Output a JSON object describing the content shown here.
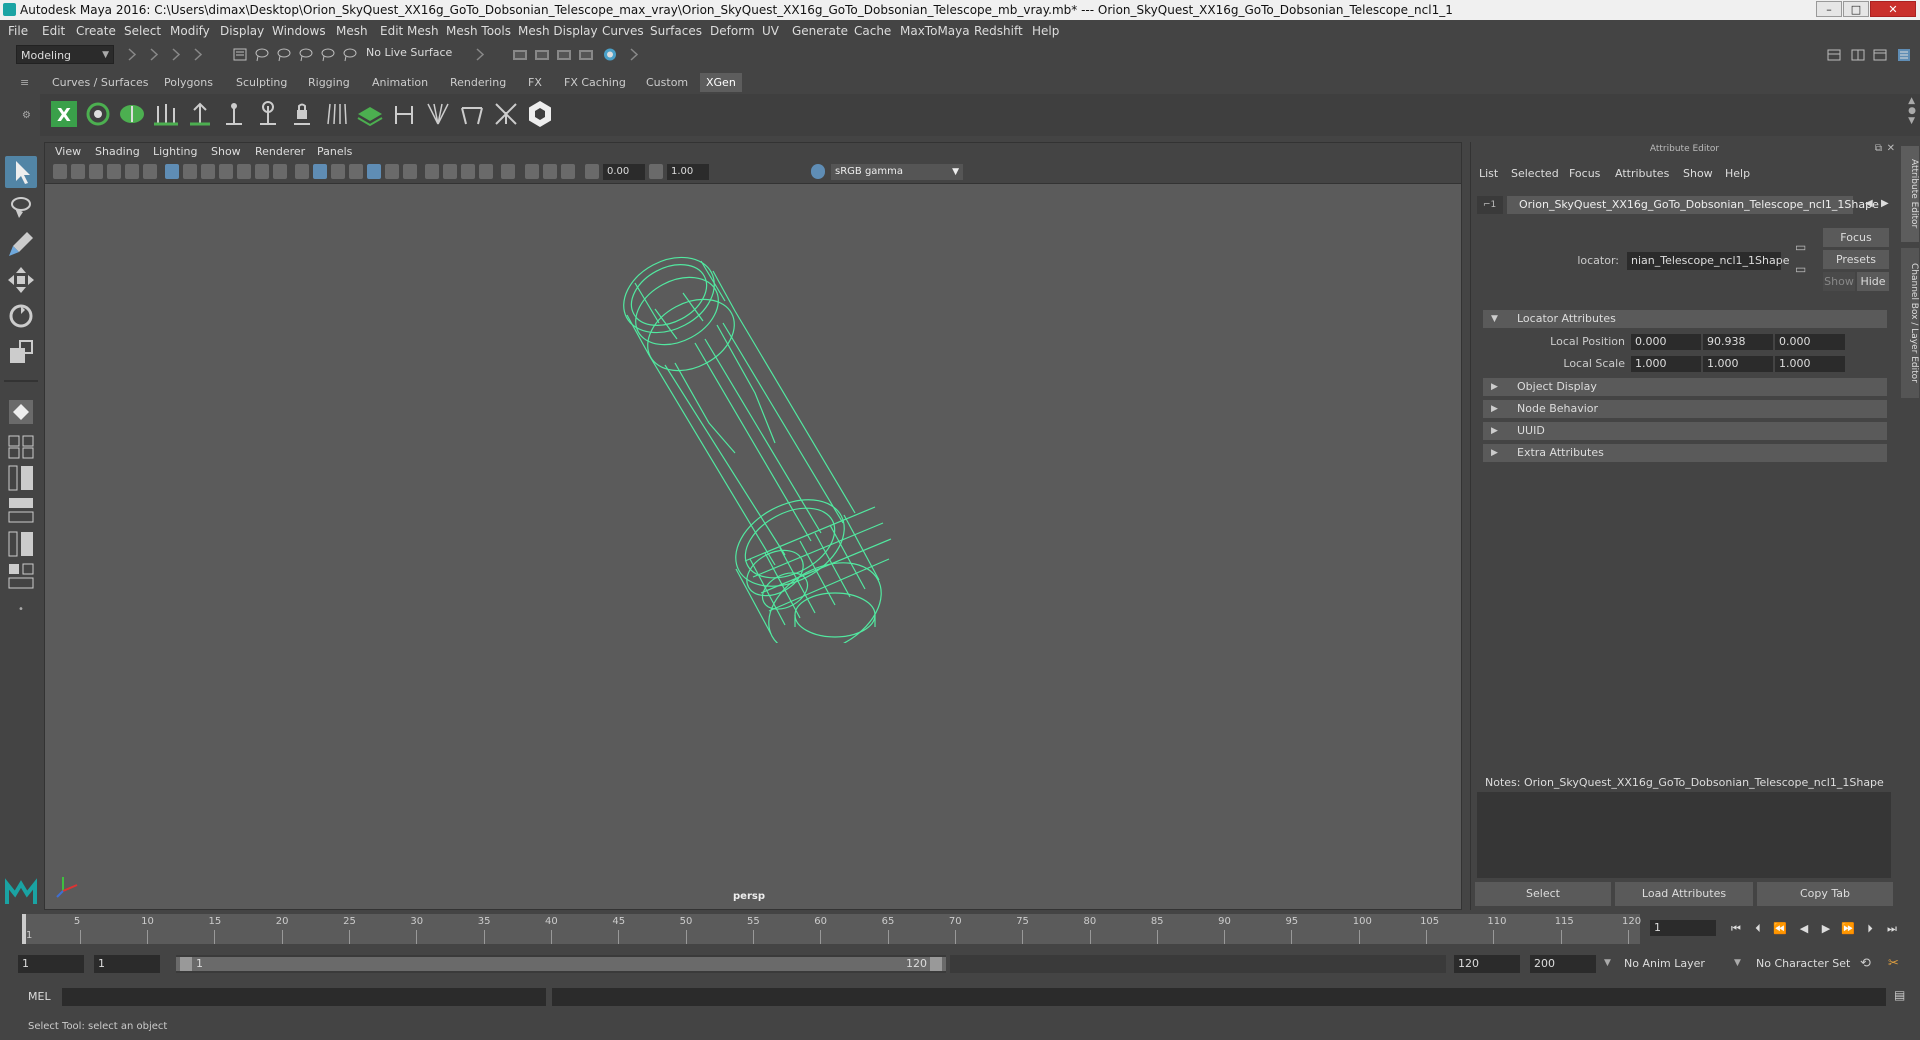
{
  "window": {
    "title": "Autodesk Maya 2016: C:\\Users\\dimax\\Desktop\\Orion_SkyQuest_XX16g_GoTo_Dobsonian_Telescope_max_vray\\Orion_SkyQuest_XX16g_GoTo_Dobsonian_Telescope_mb_vray.mb*   ---   Orion_SkyQuest_XX16g_GoTo_Dobsonian_Telescope_ncl1_1",
    "minimize": "–",
    "maximize": "□",
    "close": "✕"
  },
  "menubar": [
    "File",
    "Edit",
    "Create",
    "Select",
    "Modify",
    "Display",
    "Windows",
    "Mesh",
    "Edit Mesh",
    "Mesh Tools",
    "Mesh Display",
    "Curves",
    "Surfaces",
    "Deform",
    "UV",
    "Generate",
    "Cache",
    "MaxToMaya",
    "Redshift",
    "Help"
  ],
  "status": {
    "mode": "Modeling",
    "live_surface": "No Live Surface"
  },
  "shelf_tabs": [
    "Curves / Surfaces",
    "Polygons",
    "Sculpting",
    "Rigging",
    "Animation",
    "Rendering",
    "FX",
    "FX Caching",
    "Custom",
    "XGen"
  ],
  "active_shelf_tab": "XGen",
  "viewport": {
    "menus": [
      "View",
      "Shading",
      "Lighting",
      "Show",
      "Renderer",
      "Panels"
    ],
    "exposure": "0.00",
    "gamma_value": "1.00",
    "color_space": "sRGB gamma",
    "camera_label": "persp",
    "wire_color": "#52e8a0"
  },
  "attribute_editor": {
    "title": "Attribute Editor",
    "menus": [
      "List",
      "Selected",
      "Focus",
      "Attributes",
      "Show",
      "Help"
    ],
    "node_tab": "Orion_SkyQuest_XX16g_GoTo_Dobsonian_Telescope_ncl1_1Shape",
    "locator_label": "locator:",
    "locator_value": "nian_Telescope_ncl1_1Shape",
    "focus_btn": "Focus",
    "presets_btn": "Presets",
    "show_btn": "Show",
    "hide_btn": "Hide",
    "sections": [
      {
        "label": "Locator Attributes",
        "expanded": true
      },
      {
        "label": "Object Display",
        "expanded": false
      },
      {
        "label": "Node Behavior",
        "expanded": false
      },
      {
        "label": "UUID",
        "expanded": false
      },
      {
        "label": "Extra Attributes",
        "expanded": false
      }
    ],
    "local_position_label": "Local Position",
    "local_position": [
      "0.000",
      "90.938",
      "0.000"
    ],
    "local_scale_label": "Local Scale",
    "local_scale": [
      "1.000",
      "1.000",
      "1.000"
    ],
    "notes": "Notes:  Orion_SkyQuest_XX16g_GoTo_Dobsonian_Telescope_ncl1_1Shape",
    "bottom_buttons": [
      "Select",
      "Load Attributes",
      "Copy Tab"
    ]
  },
  "side_tabs": [
    "Attribute Editor",
    "Channel Box / Layer Editor"
  ],
  "timeline": {
    "ticks": [
      "5",
      "10",
      "15",
      "20",
      "25",
      "30",
      "35",
      "40",
      "45",
      "50",
      "55",
      "60",
      "65",
      "70",
      "75",
      "80",
      "85",
      "90",
      "95",
      "100",
      "105",
      "110",
      "115",
      "120"
    ],
    "start_label": "1",
    "current_frame": "1"
  },
  "range": {
    "start": "1",
    "playback_start": "1",
    "slider_start": "1",
    "slider_end": "120",
    "playback_end": "120",
    "end": "200",
    "anim_layer": "No Anim Layer",
    "character_set": "No Character Set"
  },
  "cmdline": {
    "label": "MEL"
  },
  "help_line": "Select Tool: select an object"
}
